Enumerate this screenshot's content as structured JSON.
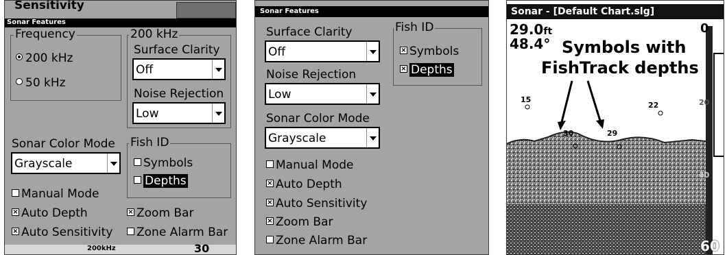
{
  "panel1": {
    "behind_title": "Sensitivity",
    "title": "Sonar Features",
    "frequency_legend": "Frequency",
    "freq_options": [
      "200 kHz",
      "50 kHz"
    ],
    "freq_selected": "200 kHz",
    "kHz_legend": "200 kHz",
    "surface_clarity_label": "Surface Clarity",
    "surface_clarity_value": "Off",
    "noise_rejection_label": "Noise Rejection",
    "noise_rejection_value": "Low",
    "color_mode_label": "Sonar Color Mode",
    "color_mode_value": "Grayscale",
    "fish_id_legend": "Fish ID",
    "fish_symbols": "Symbols",
    "fish_depths": "Depths",
    "manual_mode": "Manual Mode",
    "auto_depth": "Auto Depth",
    "auto_sensitivity": "Auto Sensitivity",
    "zoom_bar": "Zoom Bar",
    "zone_alarm_bar": "Zone Alarm Bar",
    "bottom_fragment_1": "200kHz",
    "bottom_fragment_2": "30"
  },
  "panel2": {
    "title": "Sonar Features",
    "surface_clarity_label": "Surface Clarity",
    "surface_clarity_value": "Off",
    "noise_rejection_label": "Noise Rejection",
    "noise_rejection_value": "Low",
    "color_mode_label": "Sonar Color Mode",
    "color_mode_value": "Grayscale",
    "fish_id_legend": "Fish ID",
    "fish_symbols": "Symbols",
    "fish_depths": "Depths",
    "manual_mode": "Manual Mode",
    "auto_depth": "Auto Depth",
    "auto_sensitivity": "Auto Sensitivity",
    "zoom_bar": "Zoom Bar",
    "zone_alarm_bar": "Zone Alarm Bar"
  },
  "panel3": {
    "title": "Sonar - [Default Chart.slg]",
    "depth_readout": "29.0",
    "depth_unit": "ft",
    "temp_readout": "48.4°",
    "annotation_line1": "Symbols with",
    "annotation_line2": "FishTrack depths",
    "fish_depths": [
      "15",
      "22",
      "30",
      "29"
    ],
    "scale_top": "0",
    "scale_20": "20",
    "scale_40": "40",
    "scale_bottom": "60"
  },
  "colors": {
    "screen_bg": "#a4a4a4",
    "titlebar": "#000000",
    "highlight": "#000000"
  }
}
